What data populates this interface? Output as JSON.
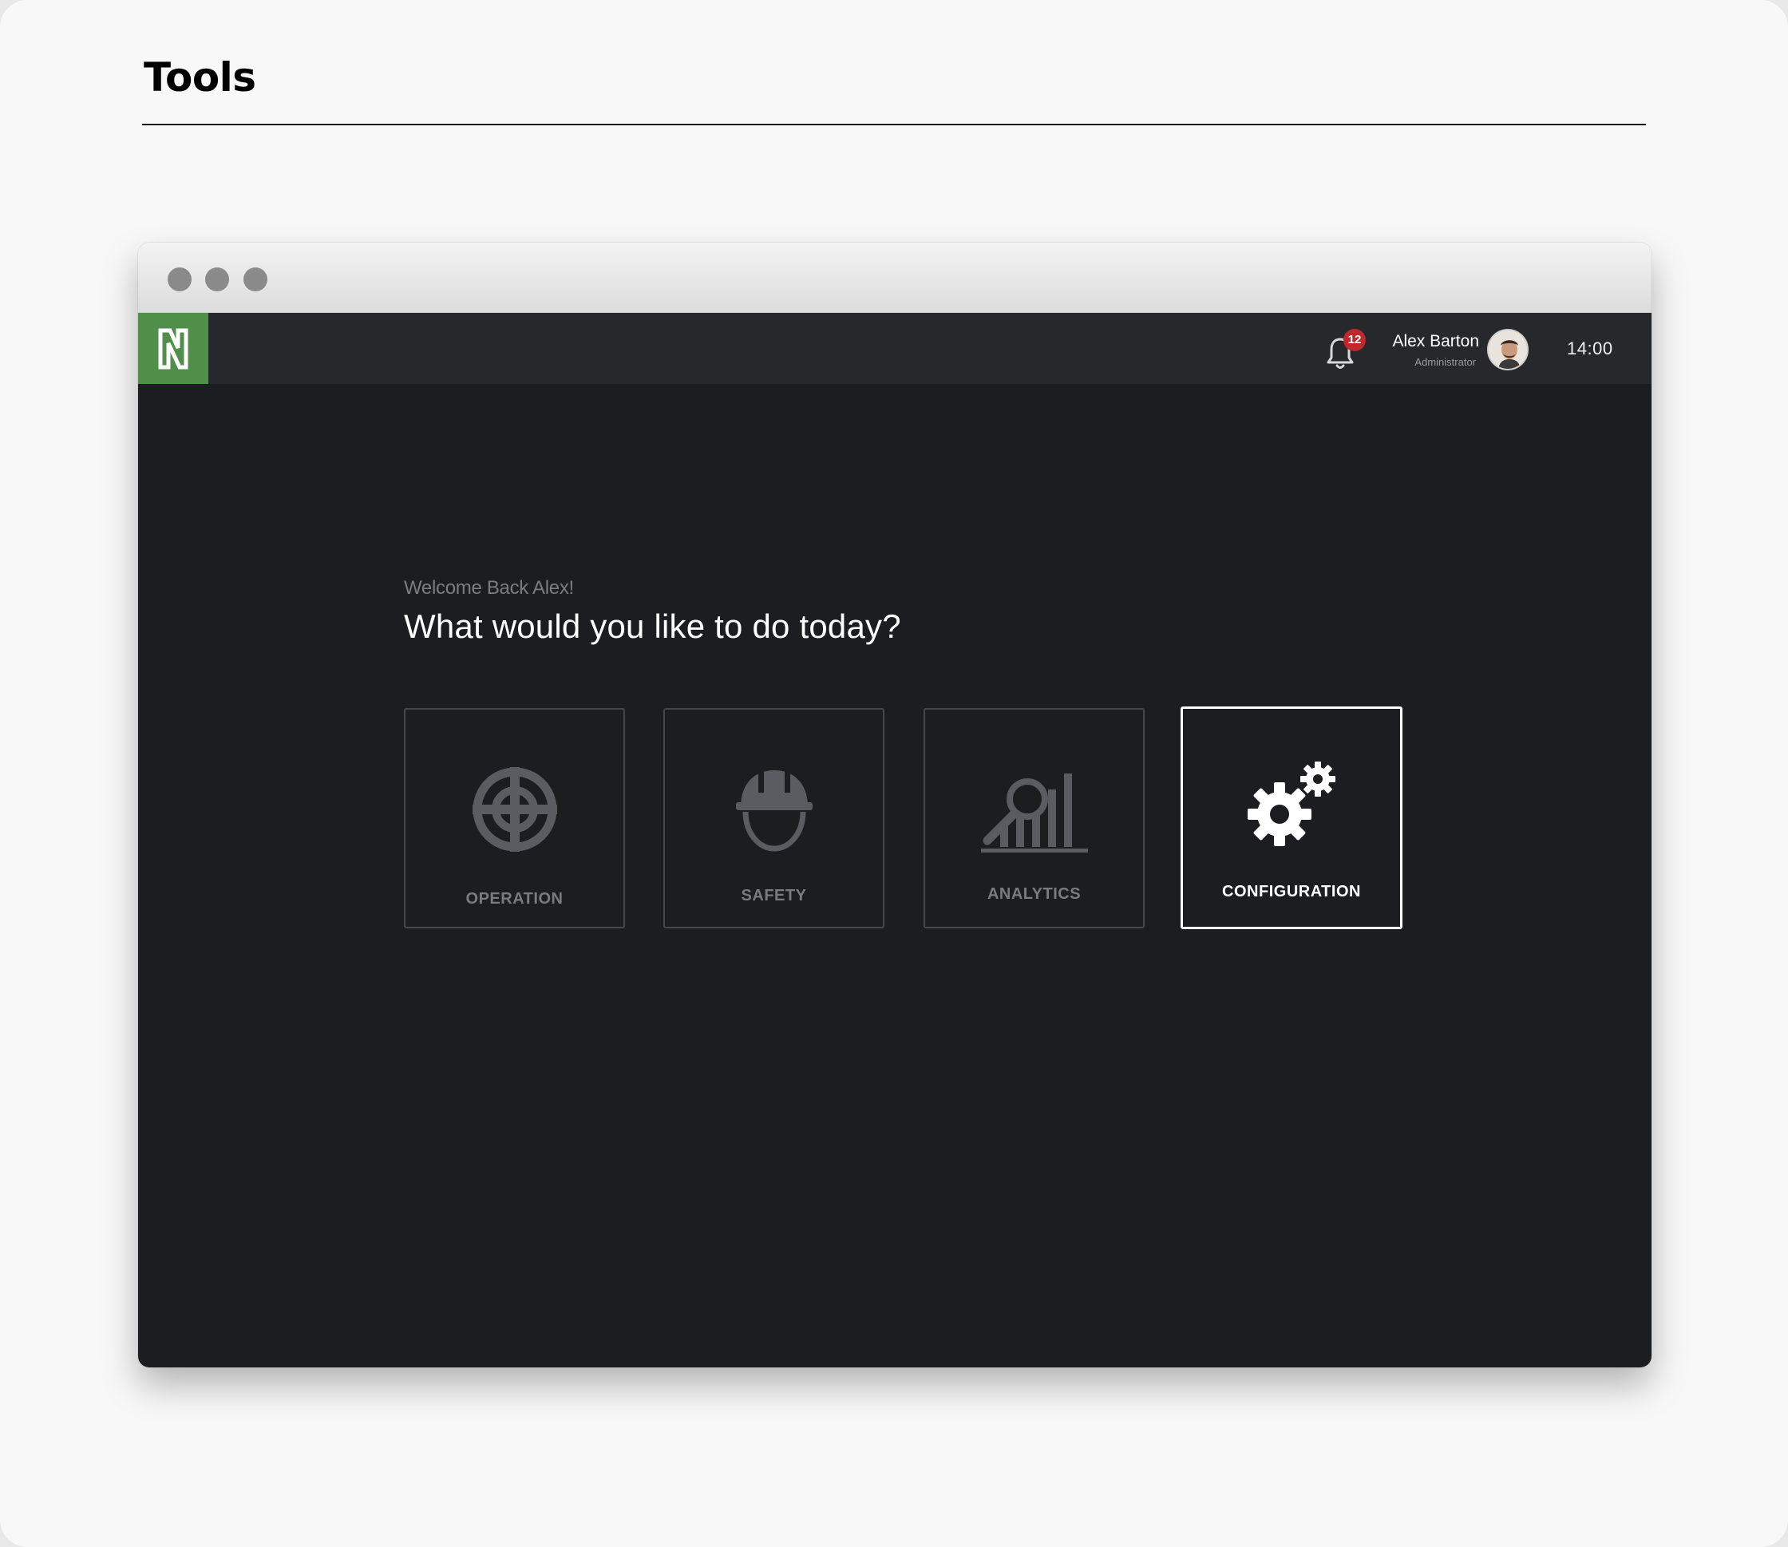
{
  "page": {
    "title": "Tools"
  },
  "header": {
    "notifications_count": "12",
    "user": {
      "name": "Alex Barton",
      "role": "Administrator"
    },
    "time": "14:00"
  },
  "main": {
    "welcome": "Welcome Back Alex!",
    "question": "What would you like to do today?",
    "tiles": [
      {
        "label": "OPERATION",
        "icon": "crosshair-icon",
        "selected": false
      },
      {
        "label": "SAFETY",
        "icon": "hard-hat-icon",
        "selected": false
      },
      {
        "label": "ANALYTICS",
        "icon": "analytics-icon",
        "selected": false
      },
      {
        "label": "CONFIGURATION",
        "icon": "gears-icon",
        "selected": true
      }
    ]
  },
  "colors": {
    "brand": "#4f8f4a",
    "badge": "#c0282b",
    "background": "#1c1d21",
    "topbar": "#27282c",
    "muted_icon": "#5a5c62"
  }
}
